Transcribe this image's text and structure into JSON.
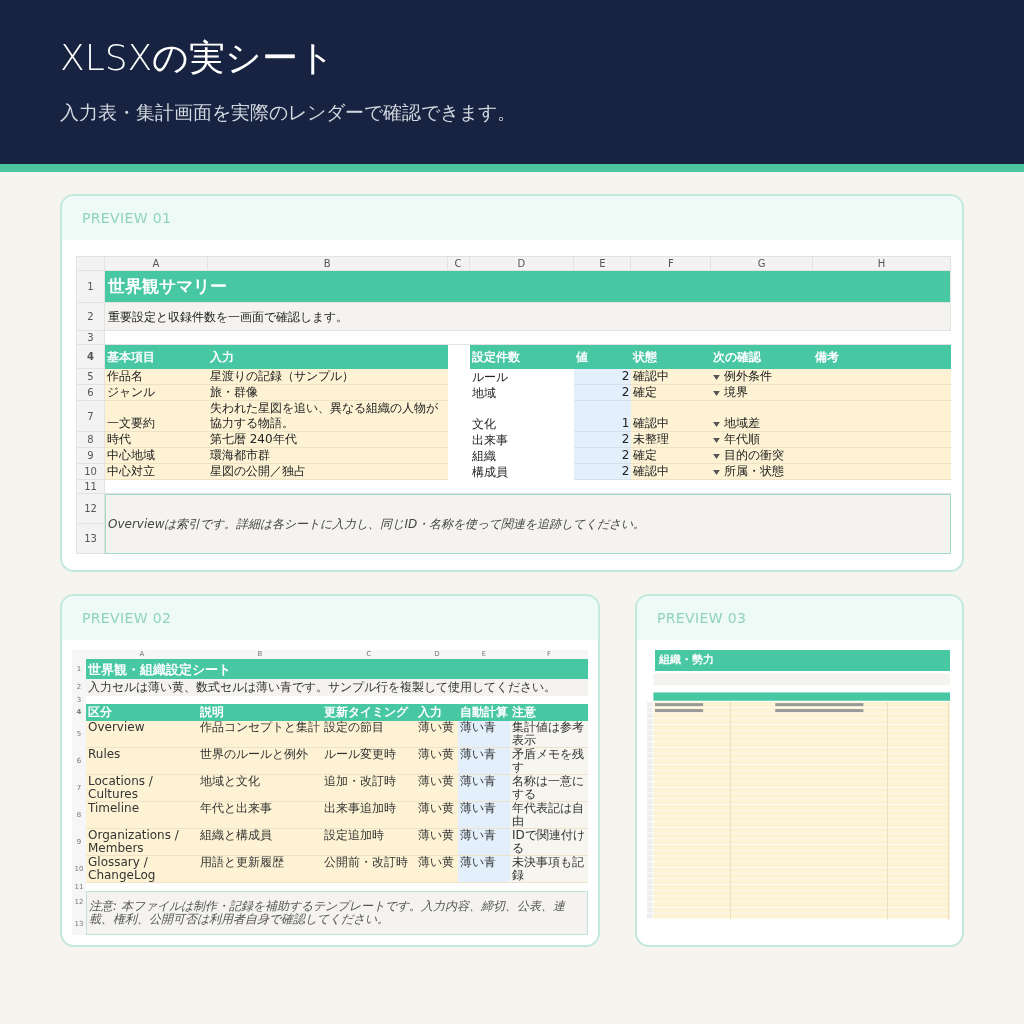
{
  "header": {
    "title": "XLSXの実シート",
    "subtitle": "入力表・集計画面を実際のレンダーで確認できます。"
  },
  "preview_01": {
    "label": "PREVIEW 01",
    "columns": [
      "A",
      "B",
      "C",
      "D",
      "E",
      "F",
      "G",
      "H"
    ],
    "row_numbers": [
      "1",
      "2",
      "3",
      "4",
      "5",
      "6",
      "7",
      "8",
      "9",
      "10",
      "11",
      "12",
      "13"
    ],
    "title": "世界観サマリー",
    "description": "重要設定と収録件数を一画面で確認します。",
    "basics_header": [
      "基本項目",
      "入力"
    ],
    "counts_header": [
      "設定件数",
      "値",
      "状態",
      "次の確認",
      "備考"
    ],
    "rows": [
      {
        "item": "作品名",
        "value": "星渡りの記録（サンプル）",
        "name": "ルール",
        "count": "2",
        "status": "確認中",
        "next": "例外条件"
      },
      {
        "item": "ジャンル",
        "value": "旅・群像",
        "name": "地域",
        "count": "2",
        "status": "確定",
        "next": "境界"
      },
      {
        "item": "一文要約",
        "value": "失われた星図を追い、異なる組織の人物が協力する物語。",
        "name": "文化",
        "count": "1",
        "status": "確認中",
        "next": "地域差"
      },
      {
        "item": "時代",
        "value": "第七暦 240年代",
        "name": "出来事",
        "count": "2",
        "status": "未整理",
        "next": "年代順"
      },
      {
        "item": "中心地域",
        "value": "環海都市群",
        "name": "組織",
        "count": "2",
        "status": "確定",
        "next": "目的の衝突"
      },
      {
        "item": "中心対立",
        "value": "星図の公開／独占",
        "name": "構成員",
        "count": "2",
        "status": "確認中",
        "next": "所属・状態"
      }
    ],
    "note": "Overviewは索引です。詳細は各シートに入力し、同じID・名称を使って関連を追跡してください。"
  },
  "preview_02": {
    "label": "PREVIEW 02",
    "columns": [
      "A",
      "B",
      "C",
      "D",
      "E",
      "F"
    ],
    "row_numbers": [
      "1",
      "2",
      "3",
      "4",
      "5",
      "6",
      "7",
      "8",
      "9",
      "10",
      "11",
      "12",
      "13"
    ],
    "title": "世界観・組織設定シート",
    "description": "入力セルは薄い黄、数式セルは薄い青です。サンプル行を複製して使用してください。",
    "table_header": [
      "区分",
      "説明",
      "更新タイミング",
      "入力",
      "自動計算",
      "注意"
    ],
    "rows": [
      [
        "Overview",
        "作品コンセプトと集計",
        "設定の節目",
        "薄い黄",
        "薄い青",
        "集計値は参考表示"
      ],
      [
        "Rules",
        "世界のルールと例外",
        "ルール変更時",
        "薄い黄",
        "薄い青",
        "矛盾メモを残す"
      ],
      [
        "Locations / Cultures",
        "地域と文化",
        "追加・改訂時",
        "薄い黄",
        "薄い青",
        "名称は一意にする"
      ],
      [
        "Timeline",
        "年代と出来事",
        "出来事追加時",
        "薄い黄",
        "薄い青",
        "年代表記は自由"
      ],
      [
        "Organizations / Members",
        "組織と構成員",
        "設定追加時",
        "薄い黄",
        "薄い青",
        "IDで関連付ける"
      ],
      [
        "Glossary / ChangeLog",
        "用語と更新履歴",
        "公開前・改訂時",
        "薄い黄",
        "薄い青",
        "未決事項も記録"
      ]
    ],
    "note": "注意: 本ファイルは制作・記録を補助するテンプレートです。入力内容、締切、公表、連載、権利、公開可否は利用者自身で確認してください。"
  },
  "preview_03": {
    "label": "PREVIEW 03",
    "title": "組織・勢力"
  }
}
